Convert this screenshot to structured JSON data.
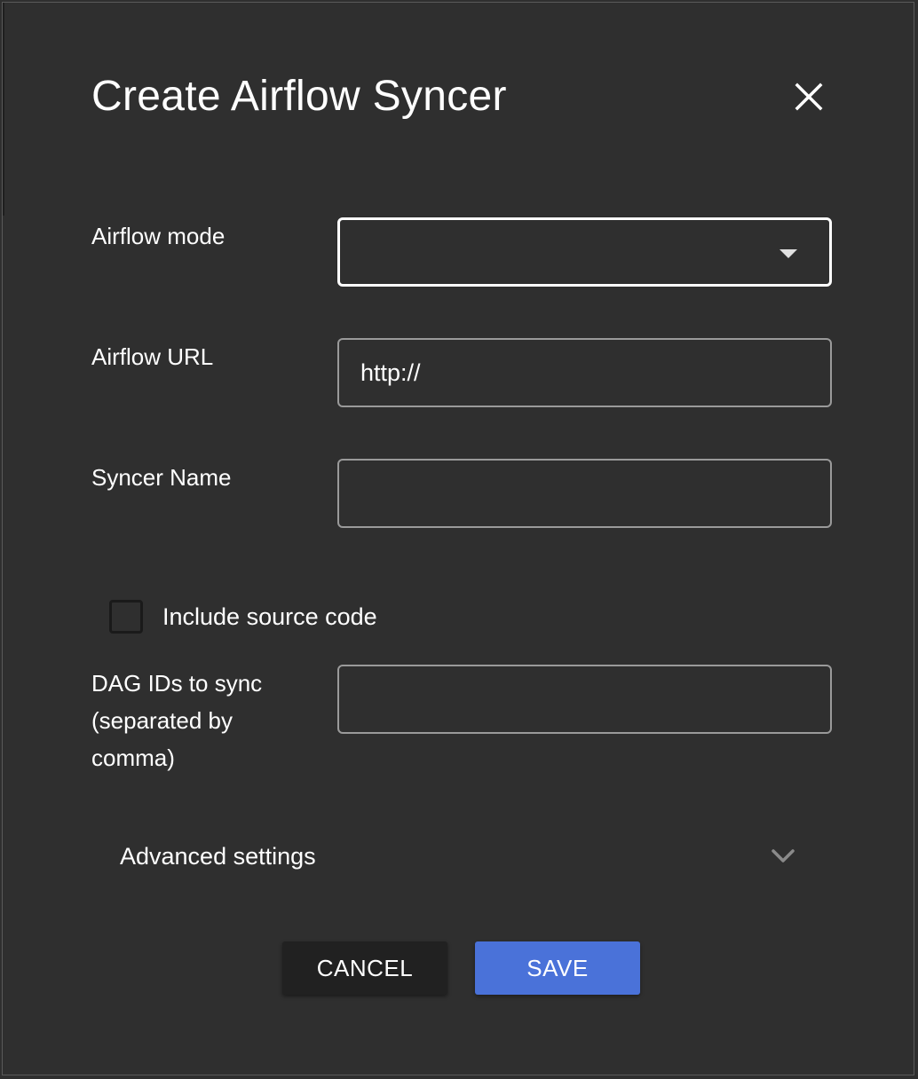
{
  "dialog": {
    "title": "Create Airflow Syncer",
    "close_icon": "close-icon"
  },
  "form": {
    "airflow_mode": {
      "label": "Airflow mode",
      "value": "",
      "icon": "dropdown-arrow-icon"
    },
    "airflow_url": {
      "label": "Airflow URL",
      "value": "http://"
    },
    "syncer_name": {
      "label": "Syncer Name",
      "value": ""
    },
    "include_source_code": {
      "label": "Include source code",
      "checked": false
    },
    "dag_ids": {
      "label_line1": "DAG IDs to sync",
      "label_line2": "(separated by",
      "label_line3": "comma)",
      "value": ""
    },
    "advanced_settings": {
      "label": "Advanced settings",
      "icon": "chevron-down-icon",
      "expanded": false
    }
  },
  "actions": {
    "cancel_label": "CANCEL",
    "save_label": "SAVE"
  },
  "colors": {
    "background": "#2f2f2f",
    "accent": "#4a72d9",
    "cancel_button": "#212121",
    "text": "#ffffff",
    "field_border": "#9a9a9a"
  }
}
